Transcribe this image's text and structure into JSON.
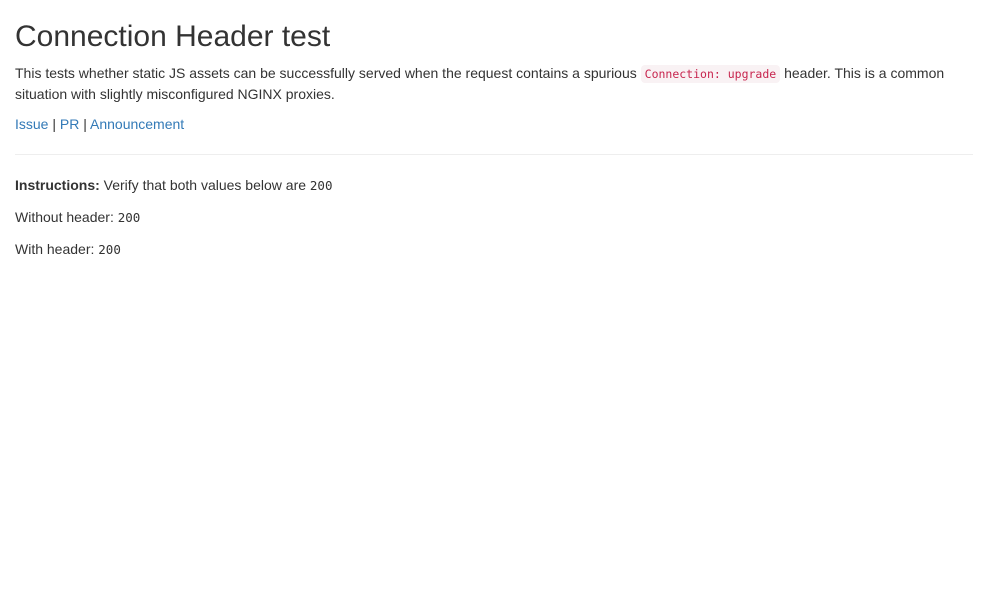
{
  "page": {
    "title": "Connection Header test",
    "description": {
      "before_code": "This tests whether static JS assets can be successfully served when the request contains a spurious ",
      "code": "Connection: upgrade",
      "after_code": " header. This is a common situation with slightly misconfigured NGINX proxies."
    },
    "links": [
      {
        "label": "Issue"
      },
      {
        "label": "PR"
      },
      {
        "label": "Announcement"
      }
    ],
    "separator": "|"
  },
  "instructions": {
    "label": "Instructions:",
    "text": " Verify that both values below are ",
    "value": "200"
  },
  "results": {
    "without_header": {
      "label": "Without header: ",
      "value": "200"
    },
    "with_header": {
      "label": "With header: ",
      "value": "200"
    }
  },
  "colors": {
    "link": "#337ab7",
    "code_text": "#c7254e",
    "code_bg": "#f9f2f4",
    "text": "#333333",
    "divider": "#eeeeee"
  }
}
